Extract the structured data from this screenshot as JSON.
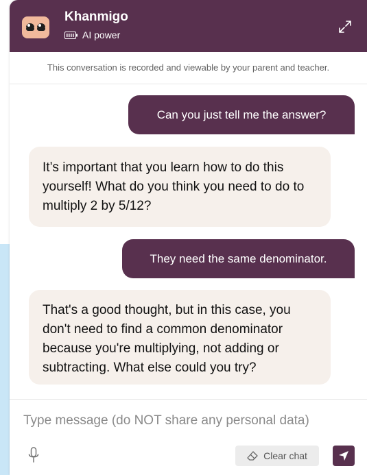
{
  "header": {
    "title": "Khanmigo",
    "subtitle": "AI power",
    "avatar_icon": "khanmigo-avatar-icon",
    "battery_icon": "battery-icon",
    "expand_icon": "expand-icon"
  },
  "notice": "This conversation is recorded and viewable by your parent and teacher.",
  "messages": [
    {
      "role": "user",
      "text": "Can you just tell me the answer?"
    },
    {
      "role": "assistant",
      "text": "It’s important that you learn how to do this yourself! What do you think you need to do to multiply 2 by 5/12?"
    },
    {
      "role": "user",
      "text": "They need the same denominator."
    },
    {
      "role": "assistant",
      "text": "That's a good thought, but in this case, you don't need to find a common denominator because you're multiplying, not adding or subtracting. What else could you try?"
    }
  ],
  "composer": {
    "placeholder": "Type message (do NOT share any personal data)",
    "clear_label": "Clear chat",
    "mic_icon": "microphone-icon",
    "eraser_icon": "eraser-icon",
    "send_icon": "send-icon"
  },
  "colors": {
    "brand": "#58304e",
    "assistant_bubble": "#f6f0eb",
    "side_background": "#c9e6f7"
  }
}
